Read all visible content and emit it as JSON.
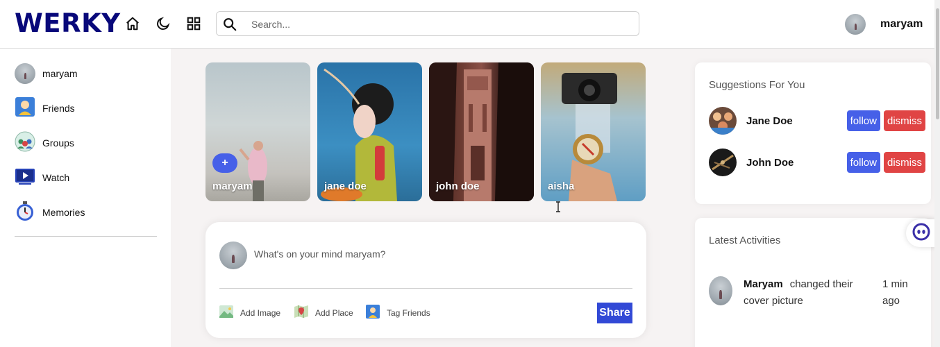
{
  "brand": {
    "logo": "WERKY"
  },
  "header": {
    "search": {
      "placeholder": "Search..."
    },
    "user_name": "maryam"
  },
  "sidebar": {
    "items": [
      {
        "label": "maryam",
        "icon": "avatar"
      },
      {
        "label": "Friends",
        "icon": "friends-icon"
      },
      {
        "label": "Groups",
        "icon": "groups-icon"
      },
      {
        "label": "Watch",
        "icon": "watch-icon"
      },
      {
        "label": "Memories",
        "icon": "stopwatch-icon"
      }
    ]
  },
  "stories": [
    {
      "name": "maryam",
      "add_label": "+"
    },
    {
      "name": "jane doe"
    },
    {
      "name": "john doe"
    },
    {
      "name": "aisha"
    }
  ],
  "share": {
    "placeholder": "What's on your mind maryam?",
    "actions": [
      {
        "label": "Add Image",
        "icon": "image-icon"
      },
      {
        "label": "Add Place",
        "icon": "map-icon"
      },
      {
        "label": "Tag Friends",
        "icon": "friends-icon"
      }
    ],
    "share_label": "Share"
  },
  "suggestions": {
    "title": "Suggestions For You",
    "users": [
      {
        "name": "Jane Doe",
        "follow": "follow",
        "dismiss": "dismiss"
      },
      {
        "name": "John Doe",
        "follow": "follow",
        "dismiss": "dismiss"
      }
    ]
  },
  "activities": {
    "title": "Latest Activities",
    "items": [
      {
        "user": "Maryam",
        "text": "changed their cover picture",
        "time": "1 min ago"
      }
    ]
  },
  "colors": {
    "brand": "#08087a",
    "primary": "#4660e8",
    "share_button": "#3249d6",
    "dismiss": "#e04444"
  }
}
